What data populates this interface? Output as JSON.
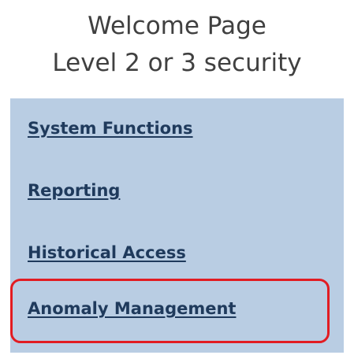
{
  "header": {
    "title_line1": "Welcome Page",
    "title_line2": "Level 2 or 3 security"
  },
  "nav": {
    "items": [
      {
        "label": "System Functions"
      },
      {
        "label": "Reporting"
      },
      {
        "label": "Historical Access"
      },
      {
        "label": "Anomaly Management"
      }
    ],
    "highlighted_item": "Anomaly Management"
  },
  "colors": {
    "panel_background": "#b9cde3",
    "link_text": "#1f3a5c",
    "highlight_border": "#e21c22",
    "title_text": "#404040"
  }
}
